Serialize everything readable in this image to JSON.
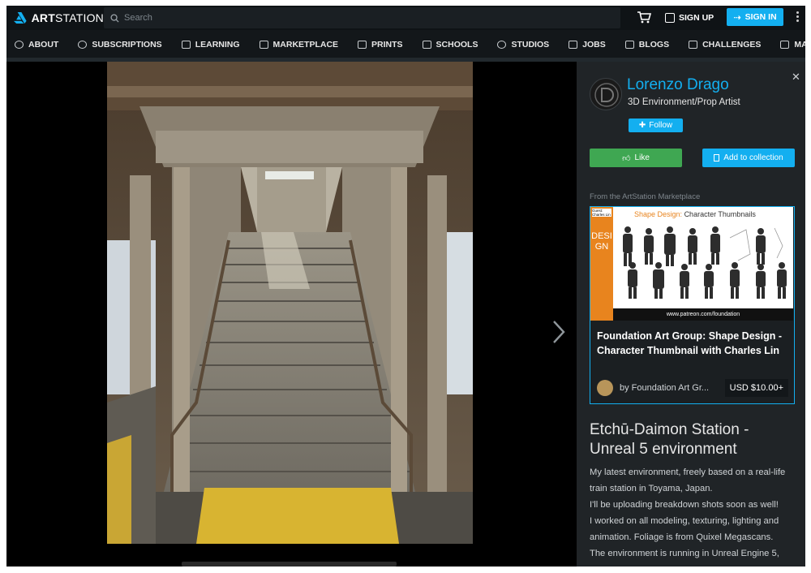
{
  "brand": {
    "name_bold": "ART",
    "name_rest": "STATION"
  },
  "search": {
    "placeholder": "Search"
  },
  "header": {
    "signup_label": "SIGN UP",
    "signin_label": "SIGN IN"
  },
  "nav": [
    {
      "label": "ABOUT",
      "icon": "info-icon"
    },
    {
      "label": "SUBSCRIPTIONS",
      "icon": "plus-circle-icon"
    },
    {
      "label": "LEARNING",
      "icon": "graduation-cap-icon"
    },
    {
      "label": "MARKETPLACE",
      "icon": "cube-icon"
    },
    {
      "label": "PRINTS",
      "icon": "print-icon"
    },
    {
      "label": "SCHOOLS",
      "icon": "school-icon"
    },
    {
      "label": "STUDIOS",
      "icon": "people-icon"
    },
    {
      "label": "JOBS",
      "icon": "briefcase-icon"
    },
    {
      "label": "BLOGS",
      "icon": "document-icon"
    },
    {
      "label": "CHALLENGES",
      "icon": "trophy-icon"
    },
    {
      "label": "MAGAZINE",
      "icon": "newspaper-icon"
    }
  ],
  "artist": {
    "name": "Lorenzo Drago",
    "title": "3D Environment/Prop Artist",
    "follow_label": "Follow"
  },
  "actions": {
    "like_label": "Like",
    "collection_label": "Add to collection"
  },
  "marketplace": {
    "label": "From the ArtStation Marketplace",
    "thumb_heading_a": "Shape Design:",
    "thumb_heading_b": "Character Thumbnails",
    "thumb_side": "DESIGN",
    "thumb_url": "www.patreon.com/foundation",
    "thumb_badge": "Guest: Charles Lin",
    "title": "Foundation Art Group: Shape Design - Character Thumbnail with Charles Lin",
    "by": "by Foundation Art Gr...",
    "price": "USD $10.00+"
  },
  "project": {
    "title": "Etchū-Daimon Station - Unreal 5 environment",
    "description": [
      "My latest environment, freely based on a real-life train station in Toyama, Japan.",
      "I'll be uploading breakdown shots soon as well!",
      "I worked on all modeling, texturing, lighting and animation. Foliage is from Quixel Megascans.",
      "The environment is running in Unreal Engine 5,"
    ]
  },
  "colors": {
    "accent": "#13aff0",
    "like": "#3fa752",
    "background": "#13171a",
    "sidebar": "#202427"
  }
}
